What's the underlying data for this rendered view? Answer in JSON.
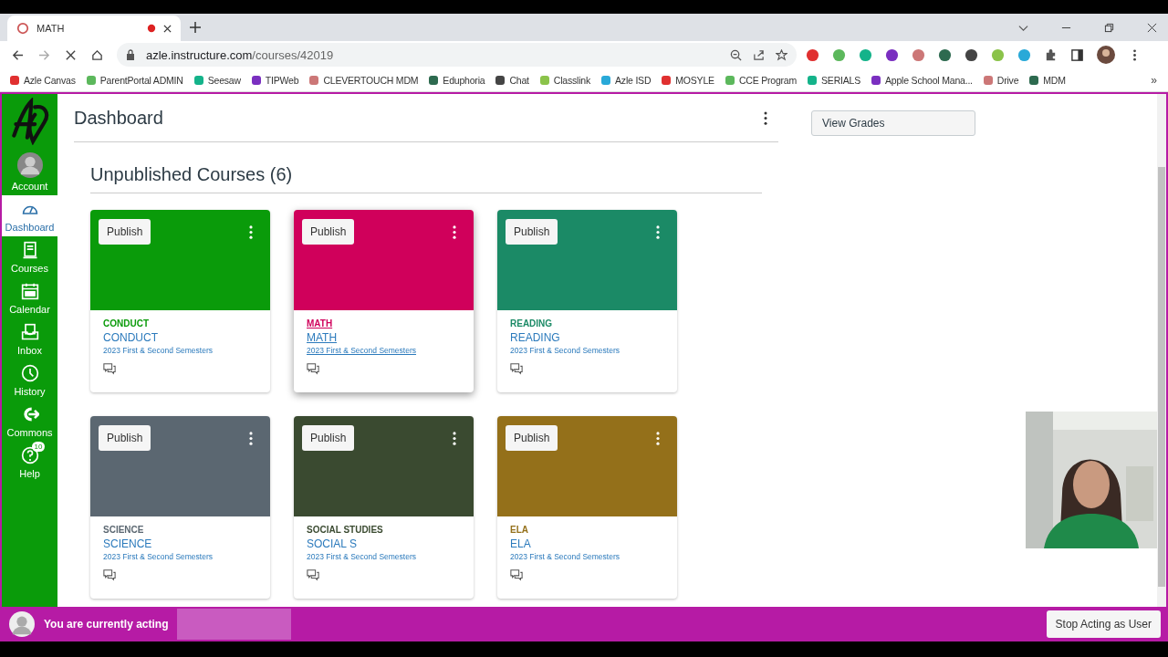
{
  "browser": {
    "tab": {
      "title": "MATH",
      "recording": true
    },
    "url": {
      "host": "azle.instructure.com",
      "path": "/courses/42019"
    },
    "bookmarks": [
      "Azle Canvas",
      "ParentPortal ADMIN",
      "Seesaw",
      "TIPWeb",
      "CLEVERTOUCH MDM",
      "Eduphoria",
      "Chat",
      "Classlink",
      "Azle ISD",
      "MOSYLE",
      "CCE Program",
      "SERIALS",
      "Apple School Mana...",
      "Drive",
      "MDM"
    ],
    "more_bookmarks": "»"
  },
  "sidebar": {
    "items": [
      {
        "kind": "account",
        "label": "Account",
        "selected": false
      },
      {
        "kind": "dashboard",
        "label": "Dashboard",
        "selected": true
      },
      {
        "kind": "courses",
        "label": "Courses",
        "selected": false
      },
      {
        "kind": "calendar",
        "label": "Calendar",
        "selected": false
      },
      {
        "kind": "inbox",
        "label": "Inbox",
        "selected": false
      },
      {
        "kind": "history",
        "label": "History",
        "selected": false
      },
      {
        "kind": "commons",
        "label": "Commons",
        "selected": false
      },
      {
        "kind": "help",
        "label": "Help",
        "selected": false,
        "badge": "10"
      }
    ]
  },
  "header": {
    "title": "Dashboard"
  },
  "section": {
    "title": "Unpublished Courses (6)"
  },
  "cards": [
    {
      "publish": "Publish",
      "short": "CONDUCT",
      "title": "CONDUCT",
      "term": "2023 First & Second Semesters",
      "color": "#0a9b0a",
      "hovered": false
    },
    {
      "publish": "Publish",
      "short": "MATH",
      "title": "MATH",
      "term": "2023 First & Second Semesters",
      "color": "#d0005b",
      "hovered": true
    },
    {
      "publish": "Publish",
      "short": "READING",
      "title": "READING",
      "term": "2023 First & Second Semesters",
      "color": "#1b8a66",
      "hovered": false
    },
    {
      "publish": "Publish",
      "short": "SCIENCE",
      "title": "SCIENCE",
      "term": "2023 First & Second Semesters",
      "color": "#5b6771",
      "hovered": false
    },
    {
      "publish": "Publish",
      "short": "SOCIAL STUDIES",
      "title": "SOCIAL S",
      "term": "2023 First & Second Semesters",
      "color": "#3a4a30",
      "hovered": false
    },
    {
      "publish": "Publish",
      "short": "ELA",
      "title": "ELA",
      "term": "2023 First & Second Semesters",
      "color": "#94701a",
      "hovered": false
    }
  ],
  "right": {
    "button": "View Grades"
  },
  "masquerade": {
    "text": "You are currently acting",
    "button": "Stop Acting as User"
  }
}
